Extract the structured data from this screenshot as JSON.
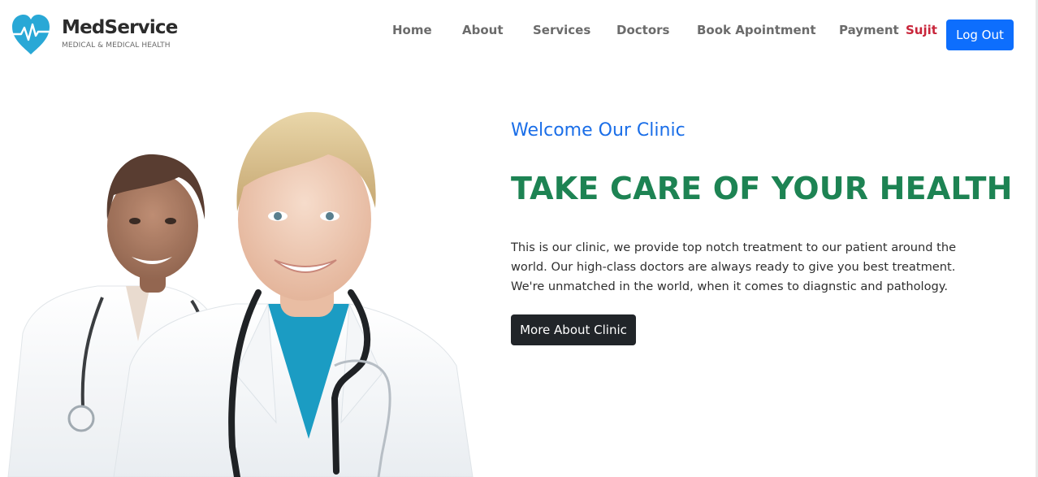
{
  "brand": {
    "name": "MedService",
    "tagline": "MEDICAL & MEDICAL HEALTH",
    "logo_icon": "heart-pulse-icon"
  },
  "nav": {
    "items": [
      {
        "label": "Home"
      },
      {
        "label": "About"
      },
      {
        "label": "Services"
      },
      {
        "label": "Doctors"
      },
      {
        "label": "Book Apointment"
      },
      {
        "label": "Payment"
      }
    ],
    "user_name": "Sujit",
    "logout_label": "Log Out"
  },
  "hero": {
    "subtitle": "Welcome Our Clinic",
    "title": "TAKE CARE OF YOUR HEALTH",
    "text": "This is our clinic, we provide top notch treatment to our patient around the world. Our high-class doctors are always ready to give you best treatment. We're unmatched in the world, when it comes to diagnstic and pathology.",
    "button_label": "More About Clinic",
    "image_subject": "two smiling doctors in white coats with stethoscopes"
  },
  "colors": {
    "brand_accent": "#29a8d6",
    "primary_button": "#0d6efd",
    "user_name": "#c8253a",
    "subtitle": "#1a6ee8",
    "title": "#1d8353",
    "dark_button": "#212529"
  }
}
